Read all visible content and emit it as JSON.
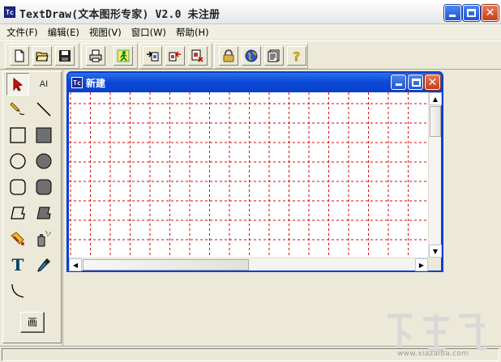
{
  "window": {
    "title": "TextDraw(文本图形专家) V2.0 未注册",
    "app_icon_text": "Tc",
    "controls": [
      "minimize",
      "maximize",
      "close"
    ]
  },
  "menubar": {
    "items": [
      {
        "label": "文件(F)"
      },
      {
        "label": "编辑(E)"
      },
      {
        "label": "视图(V)"
      },
      {
        "label": "窗口(W)"
      },
      {
        "label": "帮助(H)"
      }
    ]
  },
  "toolbar": {
    "buttons": [
      {
        "icon": "new-file-icon"
      },
      {
        "icon": "open-folder-icon"
      },
      {
        "icon": "save-disk-icon"
      },
      {
        "icon": "print-icon"
      },
      {
        "icon": "run-figure-icon"
      },
      {
        "icon": "export-icon"
      },
      {
        "icon": "import-icon"
      },
      {
        "icon": "convert-icon"
      },
      {
        "icon": "lock-icon"
      },
      {
        "icon": "globe-icon"
      },
      {
        "icon": "document-icon"
      },
      {
        "icon": "help-icon"
      }
    ]
  },
  "palette": {
    "tools": [
      {
        "icon": "select-arrow-icon",
        "selected": true
      },
      {
        "icon": "ai-text-icon",
        "label": "AI"
      },
      {
        "icon": "pencil-icon"
      },
      {
        "icon": "line-icon"
      },
      {
        "icon": "rectangle-outline-icon"
      },
      {
        "icon": "rectangle-filled-icon"
      },
      {
        "icon": "ellipse-outline-icon"
      },
      {
        "icon": "ellipse-filled-icon"
      },
      {
        "icon": "rounded-rect-outline-icon"
      },
      {
        "icon": "rounded-rect-filled-icon"
      },
      {
        "icon": "parallelogram-outline-icon"
      },
      {
        "icon": "parallelogram-filled-icon"
      },
      {
        "icon": "fill-bucket-icon"
      },
      {
        "icon": "spray-can-icon"
      },
      {
        "icon": "text-tool-icon",
        "label": "T"
      },
      {
        "icon": "eyedropper-icon"
      },
      {
        "icon": "arc-icon"
      }
    ],
    "canvas_button_label": "画"
  },
  "document_window": {
    "title": "新建",
    "app_icon_text": "Tc"
  },
  "watermark": {
    "text": "www.xiazaiba.com"
  },
  "colors": {
    "grid_line": "#e00000",
    "title_blue": "#0a48d8",
    "close_red": "#c83d17"
  }
}
